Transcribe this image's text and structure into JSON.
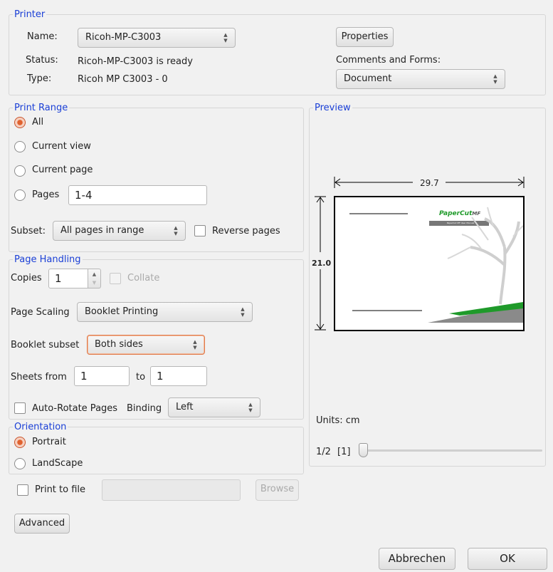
{
  "printer": {
    "title": "Printer",
    "name_label": "Name:",
    "name_value": "Ricoh-MP-C3003",
    "status_label": "Status:",
    "status_value": "Ricoh-MP-C3003 is ready",
    "type_label": "Type:",
    "type_value": "Ricoh MP C3003 -  0",
    "properties_label": "Properties",
    "comments_label": "Comments and Forms:",
    "comments_value": "Document"
  },
  "print_range": {
    "title": "Print Range",
    "all_label": "All",
    "current_view_label": "Current view",
    "current_page_label": "Current page",
    "pages_label": "Pages",
    "pages_value": "1-4",
    "subset_label": "Subset:",
    "subset_value": "All pages in range",
    "reverse_label": "Reverse pages"
  },
  "page_handling": {
    "title": "Page Handling",
    "copies_label": "Copies",
    "copies_value": "1",
    "collate_label": "Collate",
    "scaling_label": "Page Scaling",
    "scaling_value": "Booklet Printing",
    "booklet_subset_label": "Booklet subset",
    "booklet_subset_value": "Both sides",
    "sheets_from_label": "Sheets from",
    "sheets_from_value": "1",
    "sheets_to_label": "to",
    "sheets_to_value": "1",
    "auto_rotate_label": "Auto-Rotate Pages",
    "binding_label": "Binding",
    "binding_value": "Left"
  },
  "orientation": {
    "title": "Orientation",
    "portrait_label": "Portrait",
    "landscape_label": "LandScape"
  },
  "print_to_file": {
    "label": "Print to file",
    "browse_label": "Browse"
  },
  "advanced_label": "Advanced",
  "preview": {
    "title": "Preview",
    "width_value": "29.7",
    "height_value": "21.0",
    "units_label": "Units: cm",
    "page_indicator": "1/2",
    "page_bracket": "[1]",
    "page_slider": 0.0,
    "logo_text": "PaperCut",
    "logo_suffix": "MF",
    "logo_caption": "PaperCut MF User Manual"
  },
  "footer": {
    "cancel_label": "Abbrechen",
    "ok_label": "OK"
  },
  "colors": {
    "accent": "#1a3fd6",
    "radio_checked": "#e0622f",
    "logo_green": "#1f9a2a"
  }
}
